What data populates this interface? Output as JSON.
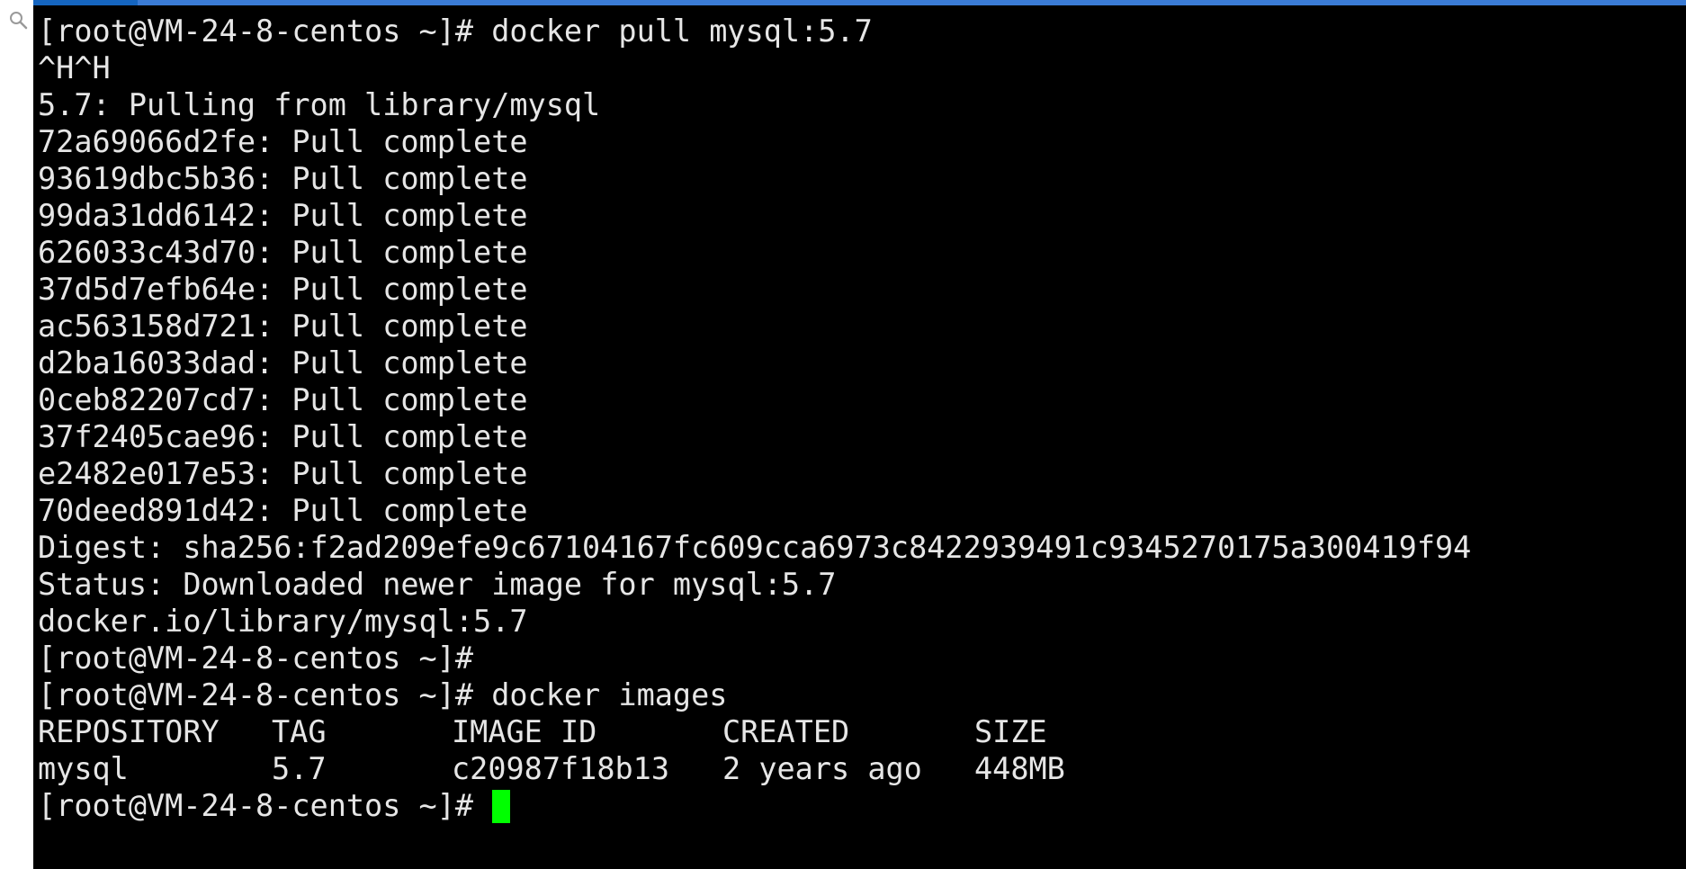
{
  "colors": {
    "terminal_background": "#000000",
    "terminal_text": "#e6e6e6",
    "cursor": "#00ff00",
    "top_bar": "#3a7bd5"
  },
  "icons": {
    "left_strip": "search-icon"
  },
  "terminal": {
    "prompt": "[root@VM-24-8-centos ~]#",
    "lines": [
      "[root@VM-24-8-centos ~]# docker pull mysql:5.7",
      "^H^H",
      "5.7: Pulling from library/mysql",
      "72a69066d2fe: Pull complete",
      "93619dbc5b36: Pull complete",
      "99da31dd6142: Pull complete",
      "626033c43d70: Pull complete",
      "37d5d7efb64e: Pull complete",
      "ac563158d721: Pull complete",
      "d2ba16033dad: Pull complete",
      "0ceb82207cd7: Pull complete",
      "37f2405cae96: Pull complete",
      "e2482e017e53: Pull complete",
      "70deed891d42: Pull complete",
      "Digest: sha256:f2ad209efe9c67104167fc609cca6973c8422939491c9345270175a300419f94",
      "Status: Downloaded newer image for mysql:5.7",
      "docker.io/library/mysql:5.7",
      "[root@VM-24-8-centos ~]#",
      "[root@VM-24-8-centos ~]# docker images"
    ],
    "images_table": {
      "headers": [
        "REPOSITORY",
        "TAG",
        "IMAGE ID",
        "CREATED",
        "SIZE"
      ],
      "rows": [
        [
          "mysql",
          "5.7",
          "c20987f18b13",
          "2 years ago",
          "448MB"
        ]
      ]
    },
    "current_prompt": "[root@VM-24-8-centos ~]# "
  }
}
